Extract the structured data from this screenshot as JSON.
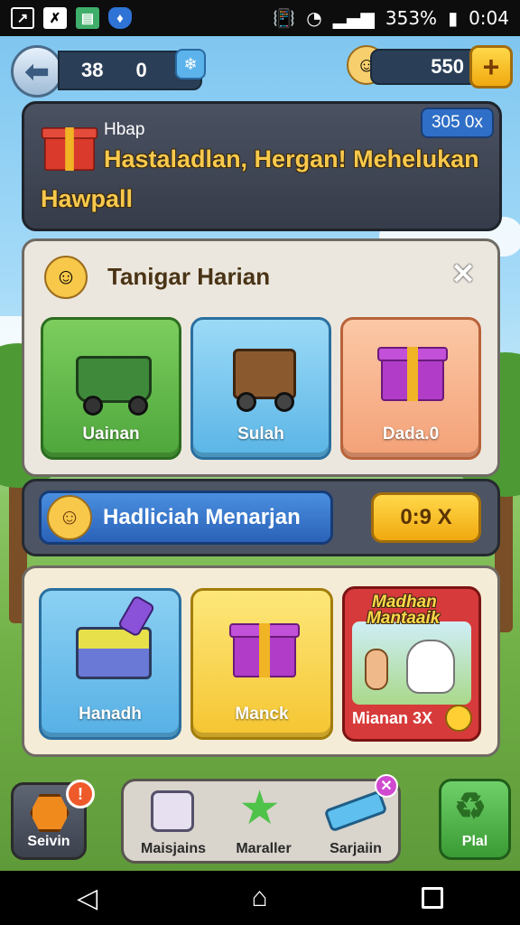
{
  "status": {
    "battery": "353%",
    "time": "0:04"
  },
  "header": {
    "count_a": "38",
    "count_b": "0",
    "coins": "550",
    "plus_label": "+"
  },
  "banner": {
    "small": "Hbap",
    "title_line1": "Hastaladlan, Hergan! Mehelukan",
    "title_line2": "Hawpall",
    "badge": "305 0x"
  },
  "daily": {
    "title": "Tanigar Harian",
    "close": "✕",
    "tiles": [
      {
        "label": "Uainan"
      },
      {
        "label": "Sulah"
      },
      {
        "label": "Dada.0"
      }
    ]
  },
  "action": {
    "label": "Hadliciah Menarjan",
    "timer": "0:9 X"
  },
  "shop": {
    "tiles": [
      {
        "label": "Hanadh"
      },
      {
        "label": "Manck"
      }
    ],
    "promo": {
      "headline_1": "Madhan",
      "headline_2": "Mantaaik",
      "footer": "Mianan 3X"
    }
  },
  "bottom": {
    "left_label": "Seivin",
    "left_badge": "!",
    "center_items": [
      {
        "label": "Maisjains"
      },
      {
        "label": "Maraller"
      },
      {
        "label": "Sarjaiin"
      }
    ],
    "right_label": "Plal"
  },
  "colors": {
    "tile_green": "#56b846",
    "tile_blue": "#6fc3ee",
    "tile_orange": "#f6b48a",
    "gold": "#f6c531",
    "action_blue": "#2f6fc7"
  }
}
